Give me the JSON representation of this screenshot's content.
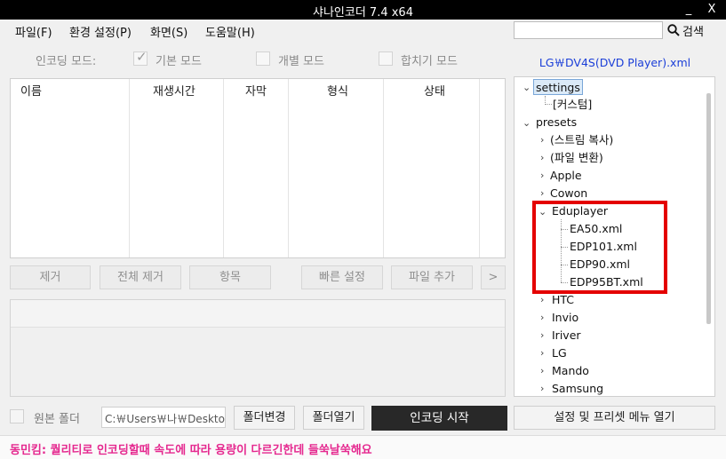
{
  "window": {
    "title": "샤나인코더  7.4  x64",
    "minimize": "_",
    "close": "X"
  },
  "menu": [
    "파일(F)",
    "환경 설정(P)",
    "화면(S)",
    "도움말(H)"
  ],
  "search": {
    "placeholder": "",
    "label": "검색"
  },
  "modes": {
    "label": "인코딩 모드:",
    "basic": "기본 모드",
    "individual": "개별 모드",
    "merge": "합치기 모드",
    "basic_checked": true
  },
  "preset_file": "LG￦DV4S(DVD Player).xml",
  "filelist": {
    "columns": [
      "이름",
      "재생시간",
      "자막",
      "형식",
      "상태"
    ]
  },
  "buttons": {
    "remove": "제거",
    "remove_all": "전체 제거",
    "items": "항목",
    "quick_settings": "빠른 설정",
    "add_file": "파일 추가",
    "more": ">"
  },
  "tree": {
    "settings": "settings",
    "custom": "[커스텀]",
    "presets": "presets",
    "nodes": [
      "(스트림 복사)",
      "(파일 변환)",
      "Apple",
      "Cowon"
    ],
    "eduplayer": "Eduplayer",
    "edu_children": [
      "EA50.xml",
      "EDP101.xml",
      "EDP90.xml",
      "EDP95BT.xml"
    ],
    "after": [
      "HTC",
      "Invio",
      "Iriver",
      "LG",
      "Mando",
      "Samsung"
    ]
  },
  "bottom": {
    "source_folder": "원본 폴더",
    "path": "C:￦Users￦나￦Desktop",
    "change_folder": "폴더변경",
    "open_folder": "폴더열기",
    "start": "인코딩 시작",
    "settings_menu": "설정 및 프리셋 메뉴 열기"
  },
  "status": "동민킴: 퀄리티로 인코딩할때 속도에 따라 용량이 다르긴한데 들쑥날쑥해요",
  "colors": {
    "accent_red": "#e40000",
    "preset_blue": "#1a3ed8",
    "status_pink": "#e5288f"
  }
}
